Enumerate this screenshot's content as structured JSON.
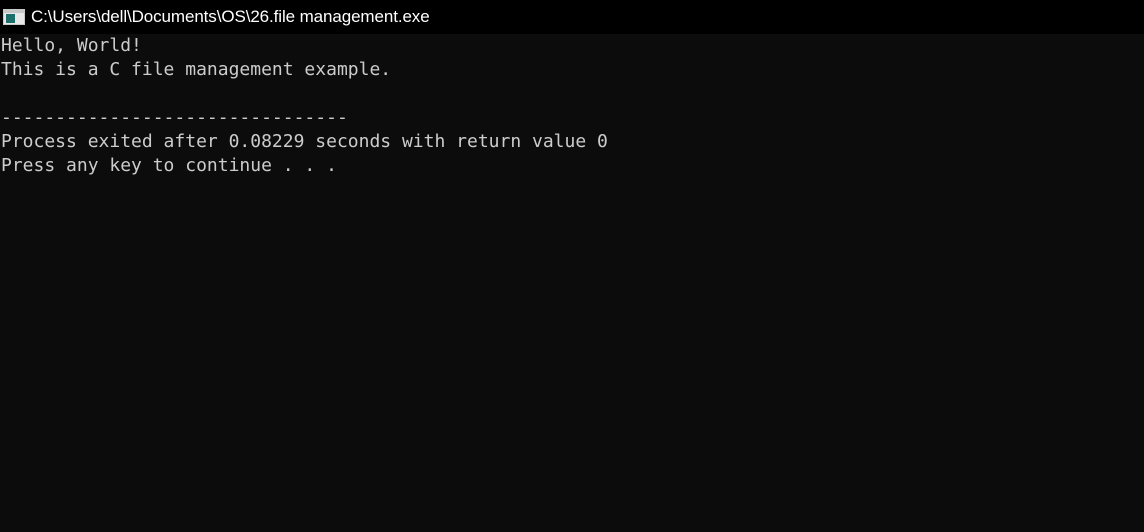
{
  "window": {
    "title": "C:\\Users\\dell\\Documents\\OS\\26.file management.exe",
    "icon": "console-window-icon"
  },
  "console": {
    "lines": [
      "Hello, World!",
      "This is a C file management example.",
      "",
      "--------------------------------",
      "Process exited after 0.08229 seconds with return value 0",
      "Press any key to continue . . ."
    ]
  },
  "colors": {
    "background": "#0c0c0c",
    "titlebar": "#000000",
    "text": "#cccccc",
    "title_text": "#ffffff"
  }
}
